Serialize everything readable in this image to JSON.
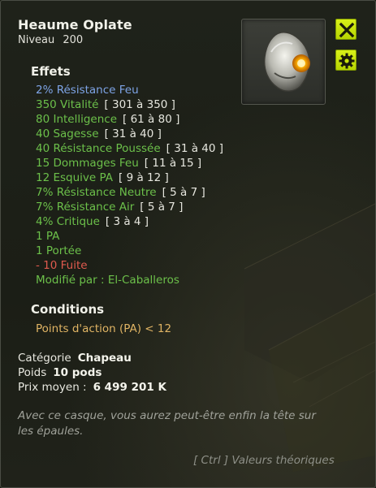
{
  "item": {
    "name": "Heaume Oplate",
    "level_label": "Niveau",
    "level": "200"
  },
  "effects_title": "Effets",
  "effects": [
    {
      "text": "2% Résistance Feu",
      "range": "",
      "color": "#7ea4e6"
    },
    {
      "text": "350 Vitalité",
      "range": "[ 301 à 350 ]",
      "color": "#6cc04a"
    },
    {
      "text": "80 Intelligence",
      "range": "[ 61 à 80 ]",
      "color": "#6cc04a"
    },
    {
      "text": "40 Sagesse",
      "range": "[ 31 à 40 ]",
      "color": "#6cc04a"
    },
    {
      "text": "40 Résistance Poussée",
      "range": "[ 31 à 40 ]",
      "color": "#6cc04a"
    },
    {
      "text": "15 Dommages Feu",
      "range": "[ 11 à 15 ]",
      "color": "#6cc04a"
    },
    {
      "text": "12 Esquive PA",
      "range": "[ 9 à 12 ]",
      "color": "#6cc04a"
    },
    {
      "text": "7% Résistance Neutre",
      "range": "[ 5 à 7 ]",
      "color": "#6cc04a"
    },
    {
      "text": "7% Résistance Air",
      "range": "[ 5 à 7 ]",
      "color": "#6cc04a"
    },
    {
      "text": "4% Critique",
      "range": "[ 3 à 4 ]",
      "color": "#6cc04a"
    },
    {
      "text": "1 PA",
      "range": "",
      "color": "#6cc04a"
    },
    {
      "text": "1 Portée",
      "range": "",
      "color": "#6cc04a"
    },
    {
      "text": "- 10 Fuite",
      "range": "",
      "color": "#e05a4e"
    },
    {
      "text": "Modifié par : El-Caballeros",
      "range": "",
      "color": "#6cc04a"
    }
  ],
  "conditions_title": "Conditions",
  "condition": "Points d'action (PA) < 12",
  "properties": {
    "category_label": "Catégorie",
    "category": "Chapeau",
    "weight_label": "Poids",
    "weight": "10 pods",
    "price_label": "Prix moyen :",
    "price": "6 499 201 K"
  },
  "description": "Avec ce casque, vous aurez peut-être enfin la tête sur les épaules.",
  "hint": "[ Ctrl ] Valeurs théoriques",
  "icons": {
    "close": "close-icon",
    "settings": "gear-icon",
    "item": "helmet-item-icon"
  },
  "colors": {
    "button_accent": "#c8e20a",
    "effect_neutral": "#7ea4e6",
    "effect_bonus": "#6cc04a",
    "effect_malus": "#e05a4e",
    "condition": "#e0b464"
  }
}
